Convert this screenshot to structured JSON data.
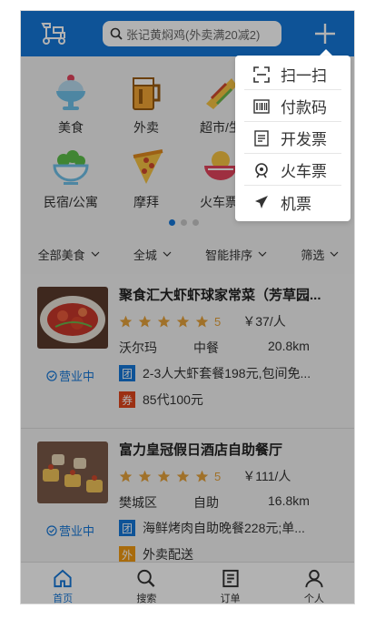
{
  "header": {
    "search_placeholder": "张记黄焖鸡(外卖满20减2)"
  },
  "categories": [
    {
      "label": "美食",
      "icon": "ice-cream-icon"
    },
    {
      "label": "外卖",
      "icon": "beer-mug-icon"
    },
    {
      "label": "超市/生",
      "icon": "candy-icon"
    },
    {
      "label": "",
      "icon": ""
    },
    {
      "label": "民宿/公寓",
      "icon": "salad-bowl-icon"
    },
    {
      "label": "摩拜",
      "icon": "pizza-icon"
    },
    {
      "label": "火车票/",
      "icon": "noodle-bowl-icon"
    }
  ],
  "pager": {
    "count": 3,
    "active": 0
  },
  "filters": [
    {
      "label": "全部美食"
    },
    {
      "label": "全城"
    },
    {
      "label": "智能排序"
    },
    {
      "label": "筛选"
    }
  ],
  "shops": [
    {
      "name": "聚食汇大虾虾球家常菜（芳草园...",
      "stars": 5,
      "score": "5",
      "price": "￥37/人",
      "area": "沃尔玛",
      "category": "中餐",
      "distance": "20.8km",
      "status": "营业中",
      "deals": [
        {
          "tag": "团",
          "color": "blue",
          "text": "2-3人大虾套餐198元,包间免..."
        },
        {
          "tag": "券",
          "color": "red",
          "text": "85代100元"
        }
      ]
    },
    {
      "name": "富力皇冠假日酒店自助餐厅",
      "stars": 5,
      "score": "5",
      "price": "￥111/人",
      "area": "樊城区",
      "category": "自助",
      "distance": "16.8km",
      "status": "营业中",
      "deals": [
        {
          "tag": "团",
          "color": "blue",
          "text": "海鲜烤肉自助晚餐228元;单..."
        },
        {
          "tag": "外",
          "color": "orange",
          "text": "外卖配送"
        }
      ]
    }
  ],
  "tabbar": [
    {
      "label": "首页",
      "icon": "home-icon",
      "active": true
    },
    {
      "label": "搜索",
      "icon": "search-icon",
      "active": false
    },
    {
      "label": "订单",
      "icon": "order-icon",
      "active": false
    },
    {
      "label": "个人",
      "icon": "person-icon",
      "active": false
    }
  ],
  "menu": [
    {
      "label": "扫一扫",
      "icon": "scan-icon"
    },
    {
      "label": "付款码",
      "icon": "barcode-icon"
    },
    {
      "label": "开发票",
      "icon": "invoice-icon"
    },
    {
      "label": "火车票",
      "icon": "train-icon"
    },
    {
      "label": "机票",
      "icon": "airplane-icon"
    }
  ],
  "colors": {
    "brand": "#1577d8",
    "star": "#e6a23c",
    "tag_red": "#e0451c",
    "tag_orange": "#f19a12"
  }
}
